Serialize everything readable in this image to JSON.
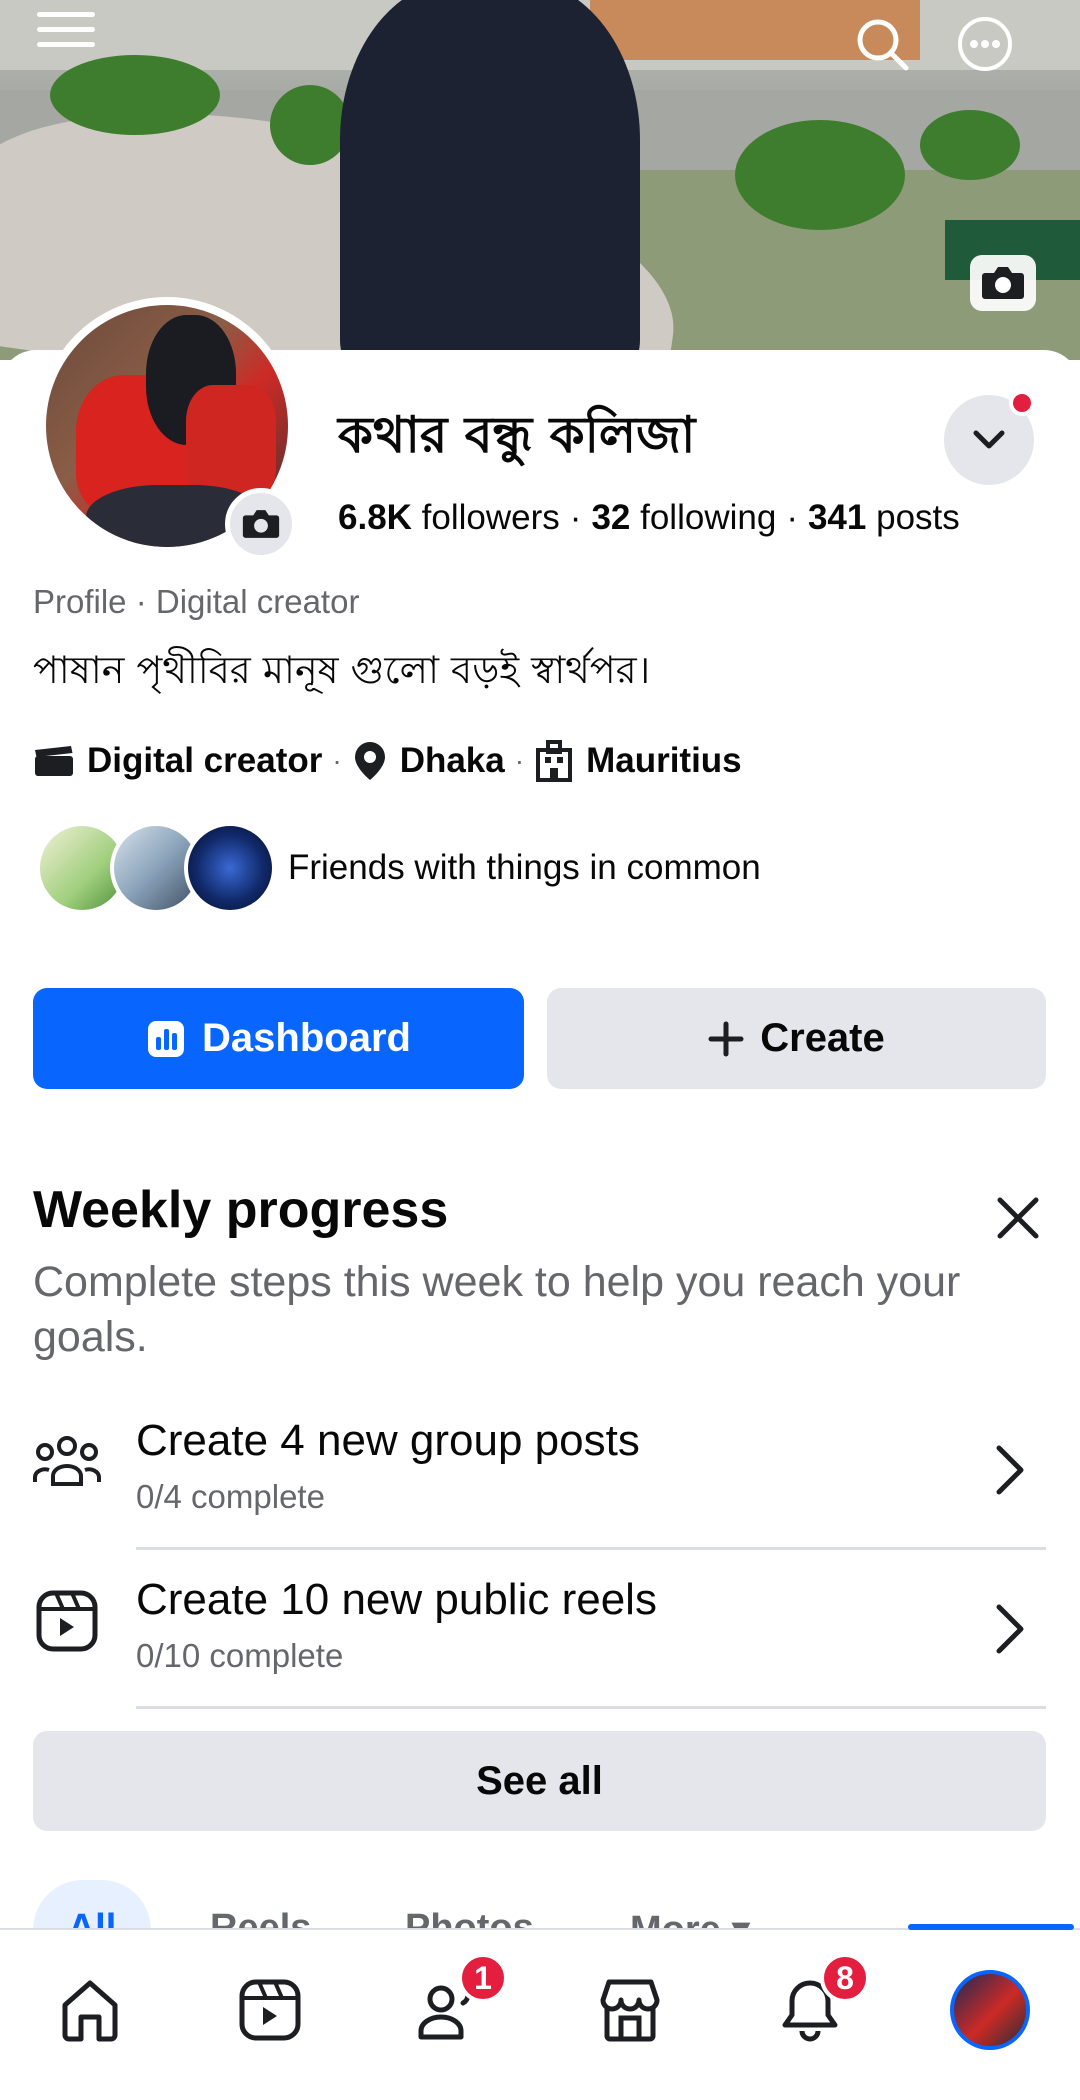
{
  "profile": {
    "name": "কথার বন্ধু কলিজা",
    "followers_count": "6.8K",
    "followers_label": "followers",
    "following_count": "32",
    "following_label": "following",
    "posts_count": "341",
    "posts_label": "posts",
    "category_line": "Profile · Digital creator",
    "bio": "পাষান পৃথীবির মানূষ গুলো বড়ই স্বার্থপর।",
    "details": [
      {
        "icon": "clapperboard-icon",
        "label": "Digital creator"
      },
      {
        "icon": "location-pin-icon",
        "label": "Dhaka"
      },
      {
        "icon": "building-icon",
        "label": "Mauritius"
      }
    ],
    "friends_text": "Friends with things in common"
  },
  "actions": {
    "dashboard_label": "Dashboard",
    "create_label": "Create"
  },
  "weekly_progress": {
    "title": "Weekly progress",
    "subtitle": "Complete steps this week to help you reach your goals.",
    "tasks": [
      {
        "icon": "group-icon",
        "title": "Create 4 new group posts",
        "status": "0/4 complete",
        "progress": 0
      },
      {
        "icon": "reels-icon",
        "title": "Create 10 new public reels",
        "status": "0/10 complete",
        "progress": 0
      }
    ],
    "see_all_label": "See all"
  },
  "tabs": [
    {
      "label": "All",
      "selected": true
    },
    {
      "label": "Reels",
      "selected": false
    },
    {
      "label": "Photos",
      "selected": false
    },
    {
      "label": "More",
      "selected": false
    }
  ],
  "bottom_nav": {
    "items": [
      {
        "icon": "home-icon",
        "badge": ""
      },
      {
        "icon": "reels-icon",
        "badge": ""
      },
      {
        "icon": "friends-icon",
        "badge": "1"
      },
      {
        "icon": "marketplace-icon",
        "badge": ""
      },
      {
        "icon": "bell-icon",
        "badge": "8"
      },
      {
        "icon": "profile-avatar",
        "badge": ""
      }
    ],
    "active_index": 5
  },
  "colors": {
    "accent": "#0866ff",
    "badge_red": "#e41e3f",
    "button_gray": "#e4e6eb",
    "secondary_text": "#65676b"
  }
}
